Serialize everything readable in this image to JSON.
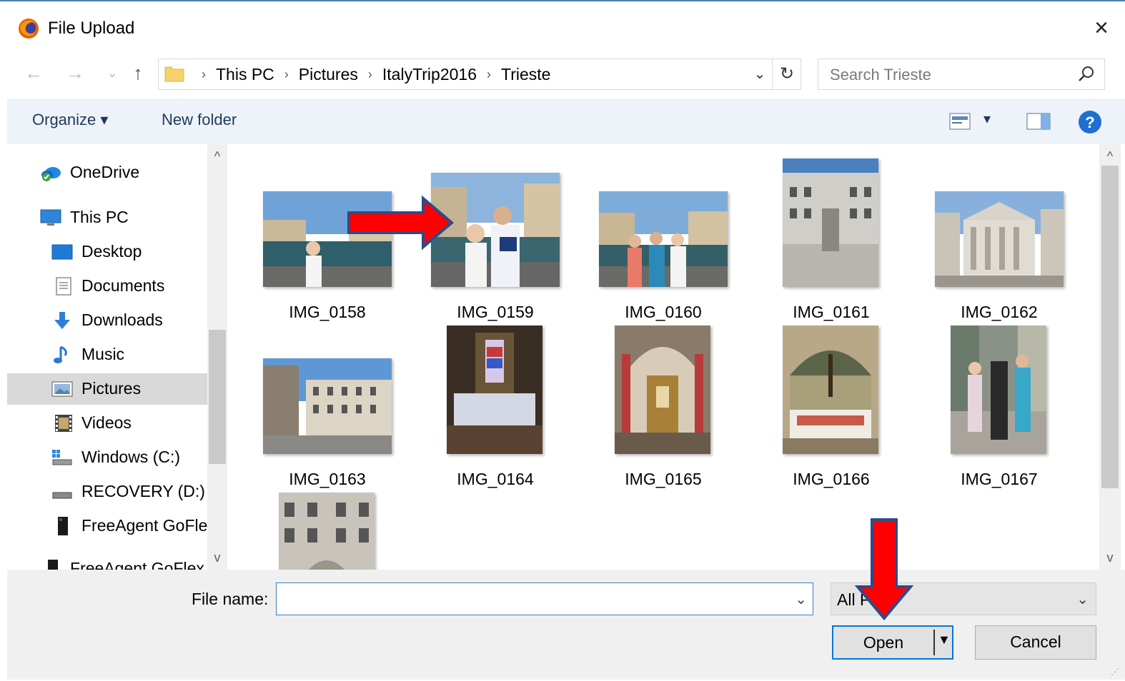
{
  "window": {
    "title": "File Upload",
    "close_icon": "×"
  },
  "nav": {
    "back_icon": "←",
    "forward_icon": "→",
    "recent_icon": "⌄",
    "up_icon": "↑",
    "breadcrumbs": [
      "This PC",
      "Pictures",
      "ItalyTrip2016",
      "Trieste"
    ],
    "separator": "›",
    "dropdown_icon": "⌄",
    "refresh_icon": "↻"
  },
  "search": {
    "placeholder": "Search Trieste"
  },
  "toolbar": {
    "organize_label": "Organize ▾",
    "new_folder_label": "New folder",
    "view_dropdown_icon": "▾",
    "help_icon": "?"
  },
  "sidebar": {
    "items": [
      {
        "label": "OneDrive",
        "icon": "onedrive-icon"
      },
      {
        "label": "This PC",
        "icon": "computer-icon"
      },
      {
        "label": "Desktop",
        "icon": "desktop-icon"
      },
      {
        "label": "Documents",
        "icon": "documents-icon"
      },
      {
        "label": "Downloads",
        "icon": "downloads-icon"
      },
      {
        "label": "Music",
        "icon": "music-icon"
      },
      {
        "label": "Pictures",
        "icon": "pictures-icon",
        "selected": true
      },
      {
        "label": "Videos",
        "icon": "videos-icon"
      },
      {
        "label": "Windows (C:)",
        "icon": "drive-c-icon"
      },
      {
        "label": "RECOVERY (D:)",
        "icon": "drive-d-icon"
      },
      {
        "label": "FreeAgent GoFle",
        "icon": "external-drive-icon"
      },
      {
        "label": "FreeAgent GoFlex",
        "icon": "external-drive-icon"
      }
    ],
    "scroll_up_icon": "^",
    "scroll_down_icon": "v"
  },
  "files": [
    {
      "name": "IMG_0158"
    },
    {
      "name": "IMG_0159"
    },
    {
      "name": "IMG_0160"
    },
    {
      "name": "IMG_0161"
    },
    {
      "name": "IMG_0162"
    },
    {
      "name": "IMG_0163"
    },
    {
      "name": "IMG_0164"
    },
    {
      "name": "IMG_0165"
    },
    {
      "name": "IMG_0166"
    },
    {
      "name": "IMG_0167"
    },
    {
      "name": ""
    }
  ],
  "bottom": {
    "file_name_label": "File name:",
    "file_name_value": "",
    "file_type_value": "All Files",
    "open_label": "Open",
    "cancel_label": "Cancel",
    "dropdown_icon": "⌄"
  },
  "annotations": {
    "arrow_color": "#ff0000",
    "arrow_outline": "#2b4c8a"
  }
}
